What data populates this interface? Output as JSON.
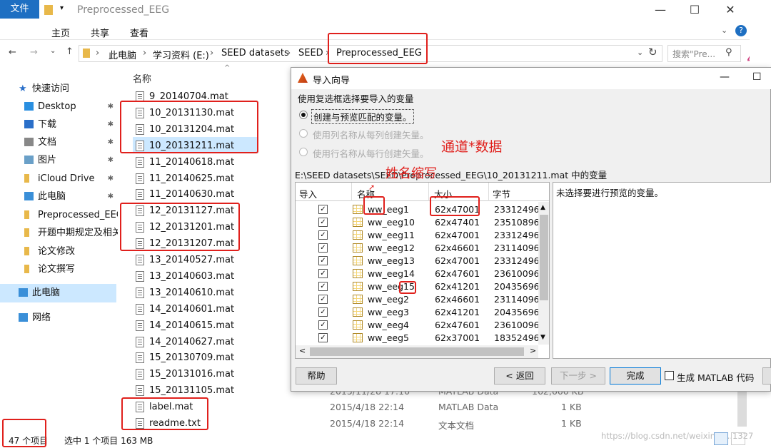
{
  "window": {
    "title": "Preprocessed_EEG",
    "minimize": "—",
    "maximize": "☐",
    "close": "✕"
  },
  "ribbon": {
    "tabs": [
      "文件",
      "主页",
      "共享",
      "查看"
    ],
    "help": "?"
  },
  "address": {
    "crumbs": [
      "此电脑",
      "学习资料 (E:)",
      "SEED datasets",
      "SEED",
      "Preprocessed_EEG"
    ],
    "search_placeholder": "搜索\"Pre...",
    "overflow_mark": "4"
  },
  "nav": {
    "items": [
      {
        "label": "快速访问",
        "icon": "star-icon",
        "pinned": false
      },
      {
        "label": "Desktop",
        "icon": "desktop-icon",
        "pinned": true
      },
      {
        "label": "下载",
        "icon": "download-icon",
        "pinned": true
      },
      {
        "label": "文档",
        "icon": "document-icon",
        "pinned": true
      },
      {
        "label": "图片",
        "icon": "picture-icon",
        "pinned": true
      },
      {
        "label": "iCloud Drive",
        "icon": "folder-icon",
        "pinned": true
      },
      {
        "label": "此电脑",
        "icon": "computer-icon",
        "pinned": true
      },
      {
        "label": "Preprocessed_EEG",
        "icon": "folder-icon",
        "pinned": false
      },
      {
        "label": "开题中期规定及相关",
        "icon": "folder-icon",
        "pinned": false
      },
      {
        "label": "论文修改",
        "icon": "folder-icon",
        "pinned": false
      },
      {
        "label": "论文撰写",
        "icon": "folder-icon",
        "pinned": false
      },
      {
        "label": "此电脑",
        "icon": "computer-icon",
        "pinned": false
      },
      {
        "label": "网络",
        "icon": "network-icon",
        "pinned": false
      }
    ]
  },
  "filelist": {
    "column_name": "名称",
    "files": [
      "9_20140704.mat",
      "10_20131130.mat",
      "10_20131204.mat",
      "10_20131211.mat",
      "11_20140618.mat",
      "11_20140625.mat",
      "11_20140630.mat",
      "12_20131127.mat",
      "12_20131201.mat",
      "12_20131207.mat",
      "13_20140527.mat",
      "13_20140603.mat",
      "13_20140610.mat",
      "14_20140601.mat",
      "14_20140615.mat",
      "14_20140627.mat",
      "15_20130709.mat",
      "15_20131016.mat",
      "15_20131105.mat",
      "label.mat",
      "readme.txt"
    ],
    "details": [
      {
        "date": "2015/11/28 17:10",
        "type": "MATLAB Data",
        "size": "162,660 KB"
      },
      {
        "date": "2015/4/18 22:14",
        "type": "MATLAB Data",
        "size": "1 KB"
      },
      {
        "date": "2015/4/18 22:14",
        "type": "文本文档",
        "size": "1 KB"
      }
    ]
  },
  "status": {
    "count": "47 个项目",
    "selected": "选中 1 个项目  163 MB",
    "watermark": "https://blog.csdn.net/weixin_4...1327"
  },
  "dialog": {
    "title": "导入向导",
    "prompt": "使用复选框选择要导入的变量",
    "options": [
      "创建与预览匹配的变量。",
      "使用列名称从每列创建矢量。",
      "使用行名称从每行创建矢量。"
    ],
    "path": "E:\\SEED datasets\\SEED\\Preprocessed_EEG\\10_20131211.mat 中的变量",
    "headers": [
      "导入",
      "名称",
      "大小",
      "字节"
    ],
    "vars": [
      {
        "name": "ww_eeg1",
        "size": "62x47001",
        "bytes": "23312496"
      },
      {
        "name": "ww_eeg10",
        "size": "62x47401",
        "bytes": "23510896"
      },
      {
        "name": "ww_eeg11",
        "size": "62x47001",
        "bytes": "23312496"
      },
      {
        "name": "ww_eeg12",
        "size": "62x46601",
        "bytes": "23114096"
      },
      {
        "name": "ww_eeg13",
        "size": "62x47001",
        "bytes": "23312496"
      },
      {
        "name": "ww_eeg14",
        "size": "62x47601",
        "bytes": "23610096"
      },
      {
        "name": "ww_eeg15",
        "size": "62x41201",
        "bytes": "20435696"
      },
      {
        "name": "ww_eeg2",
        "size": "62x46601",
        "bytes": "23114096"
      },
      {
        "name": "ww_eeg3",
        "size": "62x41201",
        "bytes": "20435696"
      },
      {
        "name": "ww_eeg4",
        "size": "62x47601",
        "bytes": "23610096"
      },
      {
        "name": "ww_eeg5",
        "size": "62x37001",
        "bytes": "18352496"
      }
    ],
    "preview_text": "未选择要进行预览的变量。",
    "buttons": {
      "help": "帮助",
      "back": "< 返回",
      "next": "下一步 >",
      "finish": "完成",
      "generate": "生成 MATLAB 代码"
    }
  },
  "annotations": {
    "channels": "通道*数据",
    "initials": "姓名缩写"
  }
}
